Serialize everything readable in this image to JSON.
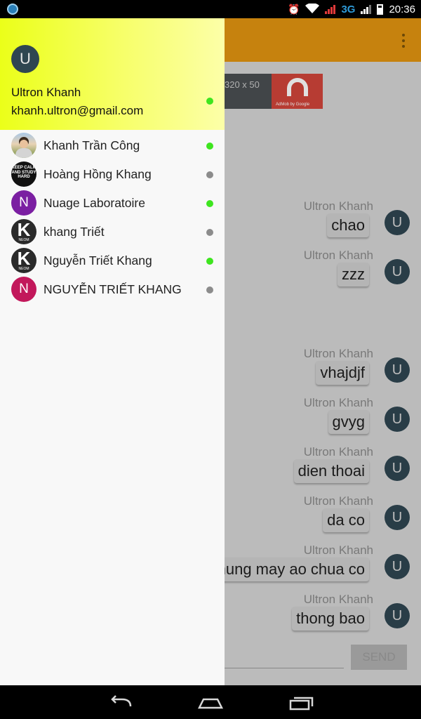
{
  "status_bar": {
    "network": "3G",
    "time": "20:36"
  },
  "chat": {
    "ad": {
      "size_text": "320 x 50",
      "caption": "AdMob by Google"
    },
    "messages": [
      {
        "sender": "Ultron Khanh",
        "text": "chao",
        "avatar_letter": "U"
      },
      {
        "sender": "Ultron Khanh",
        "text": "zzz",
        "avatar_letter": "U"
      },
      {
        "sender": "Ultron Khanh",
        "text": "vhajdjf",
        "avatar_letter": "U"
      },
      {
        "sender": "Ultron Khanh",
        "text": "gvyg",
        "avatar_letter": "U"
      },
      {
        "sender": "Ultron Khanh",
        "text": "dien thoai",
        "avatar_letter": "U"
      },
      {
        "sender": "Ultron Khanh",
        "text": "da co",
        "avatar_letter": "U"
      },
      {
        "sender": "Ultron Khanh",
        "text": "nhung may ao chua co",
        "avatar_letter": "U"
      },
      {
        "sender": "Ultron Khanh",
        "text": "thong bao",
        "avatar_letter": "U"
      }
    ],
    "send_label": "SEND"
  },
  "drawer": {
    "user": {
      "avatar_letter": "U",
      "name": "Ultron Khanh",
      "email": "khanh.ultron@gmail.com",
      "online": true
    },
    "contacts": [
      {
        "name": "Khanh Trần Công",
        "avatar": "photo",
        "online": true
      },
      {
        "name": "Hoàng Hồng Khang",
        "avatar": "keep-calm",
        "avatar_text": "KEEP CALM AND STUDY HARD",
        "online": false
      },
      {
        "name": "Nuage Laboratoire",
        "avatar": "letter",
        "avatar_letter": "N",
        "avatar_color": "#7b1fa2",
        "online": true
      },
      {
        "name": "khang Triết",
        "avatar": "neom",
        "avatar_text": "NEOM",
        "online": false
      },
      {
        "name": "Nguyễn Triết Khang",
        "avatar": "neom",
        "avatar_text": "NEOM",
        "online": true
      },
      {
        "name": "NGUYỄN TRIẾT KHANG",
        "avatar": "letter",
        "avatar_letter": "N",
        "avatar_color": "#c2185b",
        "online": false
      }
    ]
  },
  "colors": {
    "app_bar": "#e29411",
    "online": "#3ee51f",
    "offline": "#8c8c8c",
    "avatar": "#2f4651"
  }
}
